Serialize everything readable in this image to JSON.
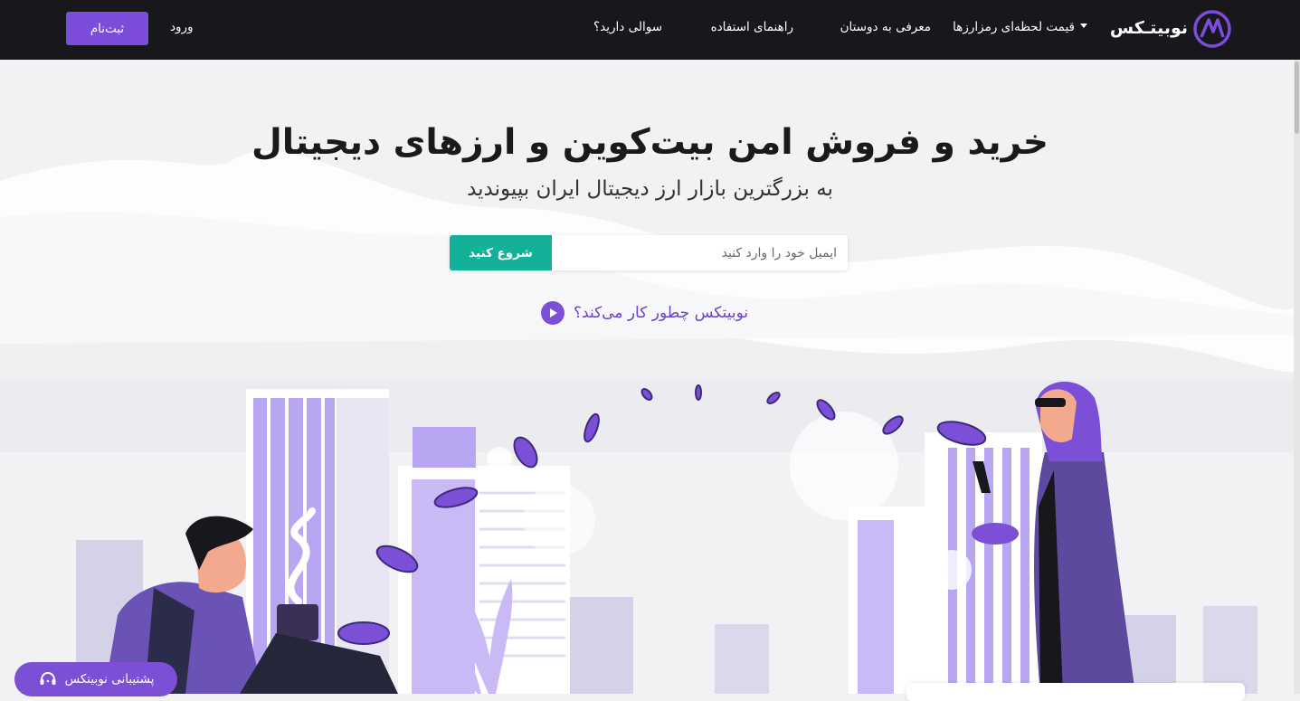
{
  "nav": {
    "brand": "نوبیتـکس",
    "links": [
      "قیمت لحظه‌ای رمزارزها",
      "معرفی به دوستان",
      "راهنمای استفاده",
      "سوالی دارید؟"
    ],
    "login": "ورود",
    "signup": "ثبت‌نام"
  },
  "hero": {
    "title": "خرید و فروش امن بیت‌کوین و ارزهای دیجیتال",
    "subtitle": "به بزرگترین بازار ارز دیجیتال ایران بپیوندید",
    "email_placeholder": "ایمیل خود را وارد کنید",
    "start_button": "شروع کنید",
    "how_it_works": "نوبیتکس چطور کار می‌کند؟"
  },
  "support": {
    "label": "پشتیبانی نوبیتکس"
  },
  "colors": {
    "navbar": "#17171c",
    "accent": "#7c4ddb",
    "start": "#14b19a"
  }
}
